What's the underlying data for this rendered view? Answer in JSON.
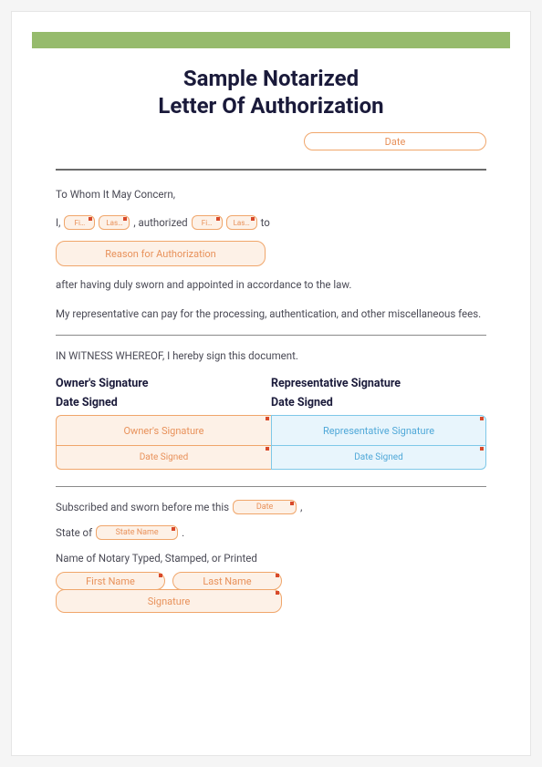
{
  "title_line1": "Sample Notarized",
  "title_line2": "Letter Of Authorization",
  "fields": {
    "date": "Date",
    "first_name_short": "Fi…",
    "last_name_short1": "Las…",
    "last_name_short2": "Las…",
    "reason": "Reason for Authorization",
    "owner_sig": "Owner's Signature",
    "rep_sig": "Representative Signature",
    "date_signed": "Date Signed",
    "sworn_date": "Date",
    "state": "State Name",
    "notary_first": "First Name",
    "notary_last": "Last Name",
    "notary_sig": "Signature"
  },
  "text": {
    "to_whom": "To Whom It May Concern,",
    "i_prefix": "I,",
    "authorized": ", authorized",
    "to": "to",
    "after_sworn": "after having duly sworn and appointed in accordance to the law.",
    "rep_can_pay": "My representative can pay for the processing, authentication, and other miscellaneous fees.",
    "witness": "IN WITNESS WHEREOF, I hereby sign this document.",
    "owner_sig_h": "Owner's Signature",
    "rep_sig_h": "Representative Signature",
    "date_signed_h": "Date Signed",
    "subscribed": "Subscribed and sworn before me this",
    "state_of": "State of",
    "period": ".",
    "comma": ",",
    "notary_name": "Name of Notary Typed, Stamped, or Printed"
  }
}
